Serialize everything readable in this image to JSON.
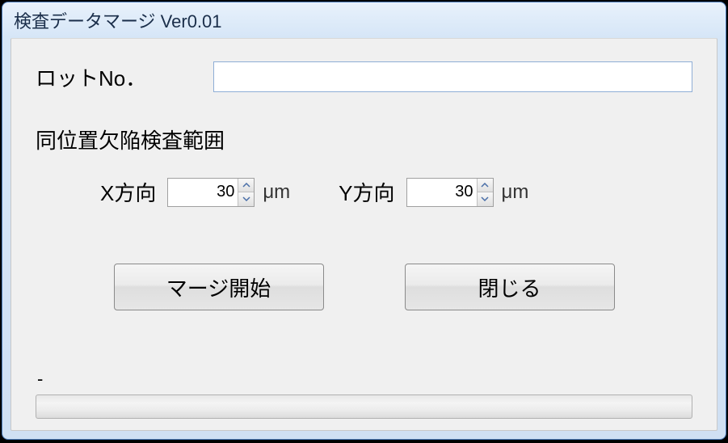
{
  "window": {
    "title": "検査データマージ Ver0.01"
  },
  "form": {
    "lot_label": "ロットNo．",
    "lot_value": "",
    "range_section_label": "同位置欠陥検査範囲",
    "x_label": "X方向",
    "x_value": "30",
    "x_unit": "μm",
    "y_label": "Y方向",
    "y_value": "30",
    "y_unit": "μm"
  },
  "buttons": {
    "merge_start": "マージ開始",
    "close": "閉じる"
  },
  "status": {
    "text": "-"
  }
}
